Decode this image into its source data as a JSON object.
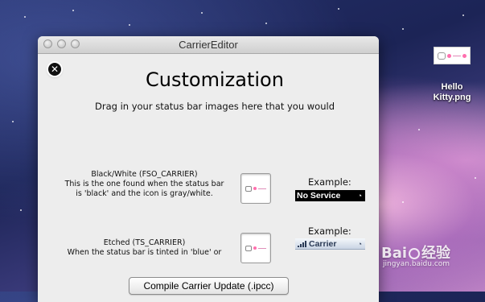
{
  "window": {
    "title": "CarrierEditor"
  },
  "header": {
    "heading": "Customization",
    "instruction": "Drag in your status bar images here that you would"
  },
  "black_white": {
    "title": "Black/White (FSO_CARRIER)",
    "line1": "This is the one found when the status bar",
    "line2": "is 'black' and the icon is gray/white.",
    "example_label": "Example:",
    "example_bar_text": "No Service"
  },
  "etched": {
    "title": "Etched (TS_CARRIER)",
    "line1": "When the status bar is tinted in 'blue' or",
    "example_label": "Example:",
    "example_bar_text": "Carrier"
  },
  "actions": {
    "compile_label": "Compile Carrier Update (.ipcc)"
  },
  "desktop": {
    "file_label_line1": "Hello",
    "file_label_line2": "Kitty.png"
  },
  "watermark": {
    "text": "Bai",
    "text2": "经验",
    "sub": "jingyan.baidu.com"
  },
  "colors": {
    "window_bg": "#ededed",
    "bar_black": "#000000",
    "bar_blue_top": "#f4f7fb"
  }
}
